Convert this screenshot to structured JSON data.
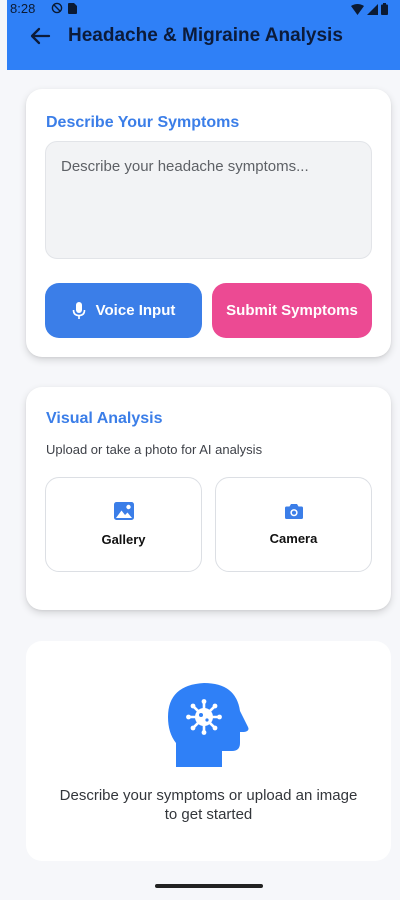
{
  "status_bar": {
    "time": "8:28"
  },
  "app_bar": {
    "title": "Headache & Migraine Analysis",
    "back_icon": "arrow-left-icon"
  },
  "symptoms_card": {
    "title": "Describe Your Symptoms",
    "input_value": "",
    "input_placeholder": "Describe your headache symptoms...",
    "voice_button_label": "Voice Input",
    "voice_button_icon": "microphone-icon",
    "submit_button_label": "Submit Symptoms"
  },
  "visual_card": {
    "title": "Visual Analysis",
    "subtitle": "Upload or take a photo for AI analysis",
    "gallery_label": "Gallery",
    "gallery_icon": "image-icon",
    "camera_label": "Camera",
    "camera_icon": "camera-icon"
  },
  "empty_state": {
    "icon": "head-virus-icon",
    "message": "Describe your symptoms or upload an image to get started"
  },
  "colors": {
    "primary": "#2f80f7",
    "accent_blue": "#3b7ee8",
    "accent_pink": "#ec4a93",
    "background": "#f6f7fa"
  }
}
